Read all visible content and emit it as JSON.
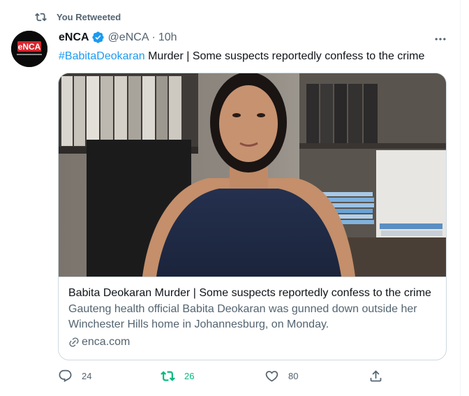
{
  "social_context": {
    "text": "You Retweeted",
    "icon": "retweet-icon"
  },
  "author": {
    "name": "eNCA",
    "handle": "@eNCA",
    "separator": "·",
    "time": "10h",
    "verified": true,
    "avatar_brand_color": "#d7262e"
  },
  "tweet": {
    "hashtag": "#BabitaDeokaran",
    "text": " Murder | Some suspects reportedly confess to the crime"
  },
  "card": {
    "title": "Babita Deokaran Murder | Some suspects reportedly confess to the crime",
    "description": "Gauteng health official Babita Deokaran was gunned down outside her Winchester Hills home in Johannesburg, on Monday.",
    "domain": "enca.com"
  },
  "actions": {
    "reply_count": "24",
    "retweet_count": "26",
    "like_count": "80",
    "retweet_active_color": "#00ba7c"
  },
  "colors": {
    "accent": "#1d9bf0",
    "secondary_text": "#536471",
    "border": "#cfd9de"
  }
}
